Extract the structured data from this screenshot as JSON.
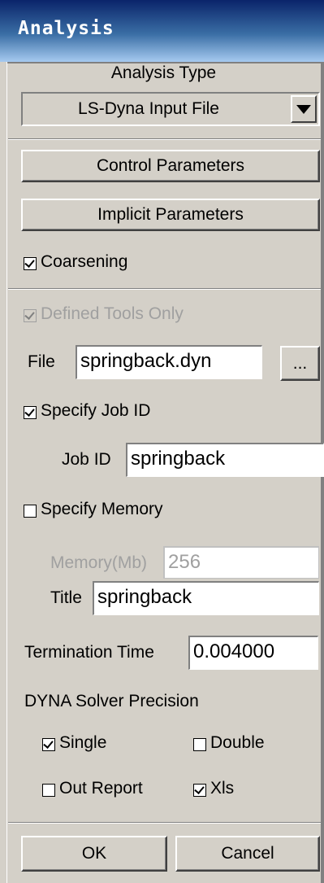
{
  "window": {
    "title": "Analysis"
  },
  "analysis_type": {
    "label": "Analysis Type",
    "selected": "LS-Dyna Input File"
  },
  "buttons": {
    "control": "Control Parameters",
    "implicit": "Implicit Parameters",
    "ok": "OK",
    "cancel": "Cancel",
    "browse": "..."
  },
  "coarsening": {
    "label": "Coarsening",
    "checked": true
  },
  "defined_tools": {
    "label": "Defined Tools  Only",
    "checked": true,
    "enabled": false
  },
  "file": {
    "label": "File",
    "value": "springback.dyn"
  },
  "specify_job": {
    "label": "Specify Job ID",
    "checked": true
  },
  "job_id": {
    "label": "Job ID",
    "value": "springback"
  },
  "specify_memory": {
    "label": "Specify Memory",
    "checked": false
  },
  "memory": {
    "label": "Memory(Mb)",
    "value": "256",
    "enabled": false
  },
  "title_field": {
    "label": "Title",
    "value": "springback"
  },
  "termination": {
    "label": "Termination Time",
    "value": "0.004000"
  },
  "precision": {
    "label": "DYNA Solver Precision",
    "single": {
      "label": "Single",
      "checked": true
    },
    "double": {
      "label": "Double",
      "checked": false
    },
    "out_report": {
      "label": "Out Report",
      "checked": false
    },
    "xls": {
      "label": "Xls",
      "checked": true
    }
  }
}
